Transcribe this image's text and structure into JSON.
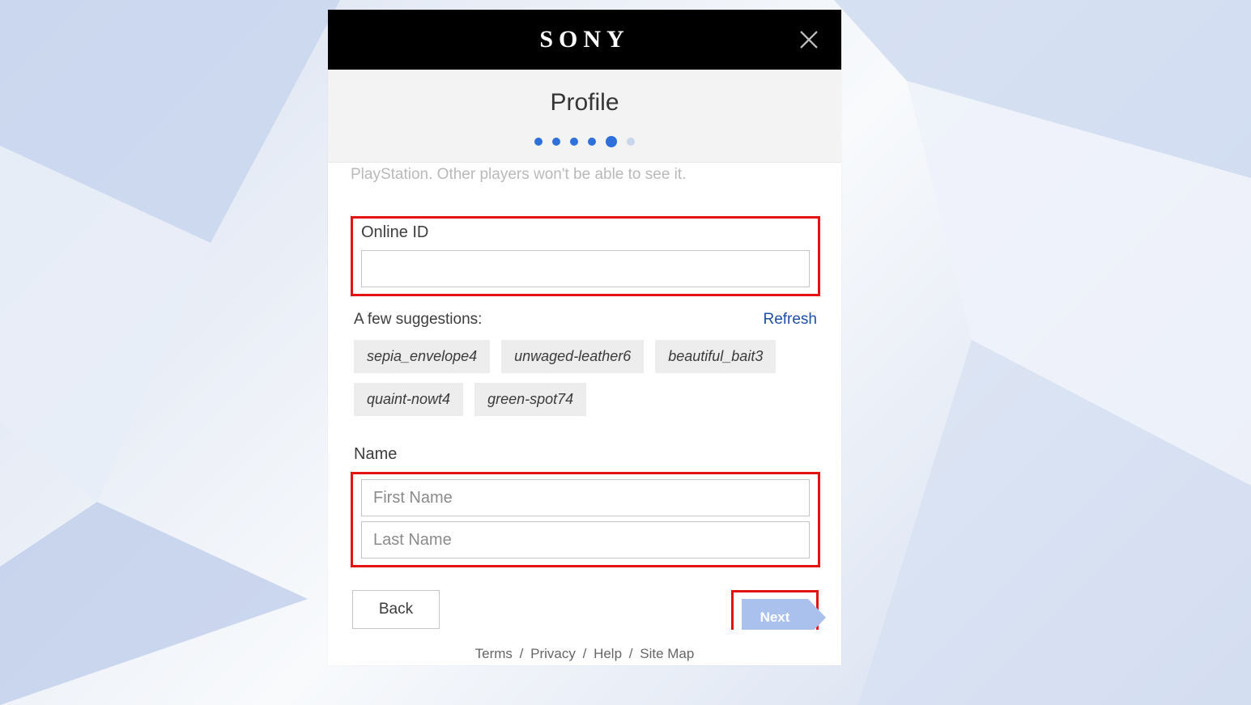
{
  "brand": "SONY",
  "page_title": "Profile",
  "progress": {
    "total": 6,
    "active_index": 4
  },
  "truncated_text": "PlayStation. Other players won't be able to see it.",
  "fields": {
    "online_id": {
      "label": "Online ID",
      "value": ""
    },
    "name": {
      "label": "Name",
      "first_placeholder": "First Name",
      "last_placeholder": "Last Name"
    }
  },
  "suggestions": {
    "label": "A few suggestions:",
    "refresh": "Refresh",
    "items": [
      "sepia_envelope4",
      "unwaged-leather6",
      "beautiful_bait3",
      "quaint-nowt4",
      "green-spot74"
    ]
  },
  "buttons": {
    "back": "Back",
    "next": "Next"
  },
  "footer": [
    "Terms",
    "Privacy",
    "Help",
    "Site Map"
  ]
}
